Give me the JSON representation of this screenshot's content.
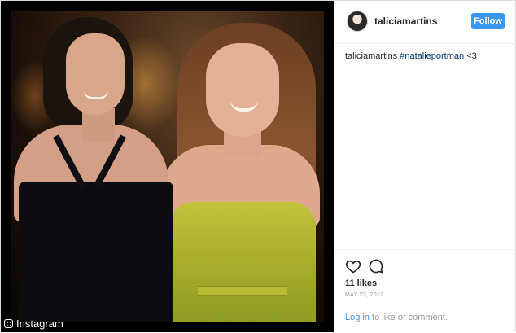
{
  "post": {
    "username": "taliciamartins",
    "follow_label": "Follow",
    "caption_user": "taliciamartins",
    "caption_tag": "#natalieportman",
    "caption_text": " <3",
    "likes": "11 likes",
    "date": "MAY 23, 2012",
    "login_link": "Log in",
    "login_text": " to like or comment."
  },
  "watermark": "Instagram",
  "icons": [
    "heart-icon",
    "comment-icon",
    "instagram-icon"
  ],
  "colors": {
    "follow_bg": "#3897f0",
    "hashtag": "#003569",
    "login_link": "#3897f0"
  }
}
